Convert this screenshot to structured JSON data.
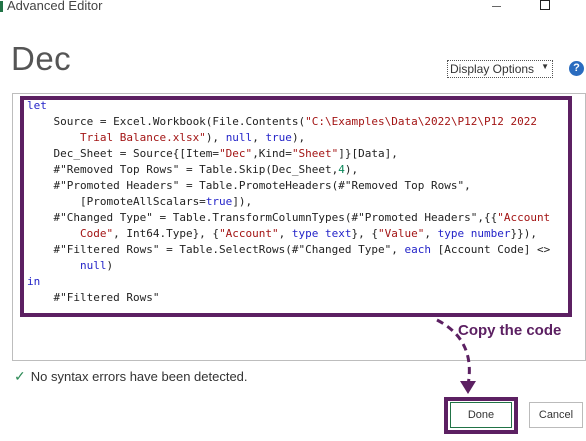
{
  "window": {
    "title": "Advanced Editor"
  },
  "query": {
    "name": "Dec"
  },
  "toolbar": {
    "display_options_label": "Display Options",
    "help_label": "?"
  },
  "code": {
    "lines": [
      [
        {
          "t": "let",
          "c": "kw"
        }
      ],
      [
        {
          "t": "    Source = Excel.Workbook(File.Contents("
        },
        {
          "t": "\"C:\\Examples\\Data\\2022\\P12\\P12 2022",
          "c": "str"
        }
      ],
      [
        {
          "t": "        Trial Balance.xlsx\"",
          "c": "str"
        },
        {
          "t": "), "
        },
        {
          "t": "null",
          "c": "kw"
        },
        {
          "t": ", "
        },
        {
          "t": "true",
          "c": "kw"
        },
        {
          "t": "),"
        }
      ],
      [
        {
          "t": "    Dec_Sheet = Source{[Item="
        },
        {
          "t": "\"Dec\"",
          "c": "str"
        },
        {
          "t": ",Kind="
        },
        {
          "t": "\"Sheet\"",
          "c": "str"
        },
        {
          "t": "]}[Data],"
        }
      ],
      [
        {
          "t": "    #\"Removed Top Rows\" = Table.Skip(Dec_Sheet,"
        },
        {
          "t": "4",
          "c": "num"
        },
        {
          "t": "),"
        }
      ],
      [
        {
          "t": "    #\"Promoted Headers\" = Table.PromoteHeaders(#\"Removed Top Rows\","
        }
      ],
      [
        {
          "t": "        [PromoteAllScalars="
        },
        {
          "t": "true",
          "c": "kw"
        },
        {
          "t": "]),"
        }
      ],
      [
        {
          "t": "    #\"Changed Type\" = Table.TransformColumnTypes(#\"Promoted Headers\",{{"
        },
        {
          "t": "\"Account",
          "c": "str"
        }
      ],
      [
        {
          "t": "        Code\"",
          "c": "str"
        },
        {
          "t": ", Int64.Type}, {"
        },
        {
          "t": "\"Account\"",
          "c": "str"
        },
        {
          "t": ", "
        },
        {
          "t": "type text",
          "c": "kw"
        },
        {
          "t": "}, {"
        },
        {
          "t": "\"Value\"",
          "c": "str"
        },
        {
          "t": ", "
        },
        {
          "t": "type number",
          "c": "kw"
        },
        {
          "t": "}}),"
        }
      ],
      [
        {
          "t": "    #\"Filtered Rows\" = Table.SelectRows(#\"Changed Type\", "
        },
        {
          "t": "each",
          "c": "kw"
        },
        {
          "t": " [Account Code] <>"
        }
      ],
      [
        {
          "t": "        "
        },
        {
          "t": "null",
          "c": "kw"
        },
        {
          "t": ")"
        }
      ],
      [
        {
          "t": "in",
          "c": "kw"
        }
      ],
      [
        {
          "t": "    #\"Filtered Rows\""
        }
      ]
    ]
  },
  "annotation": {
    "callout_text": "Copy the code",
    "accent_color": "#5c2062"
  },
  "status": {
    "message": "No syntax errors have been detected."
  },
  "footer": {
    "done_label": "Done",
    "cancel_label": "Cancel"
  }
}
